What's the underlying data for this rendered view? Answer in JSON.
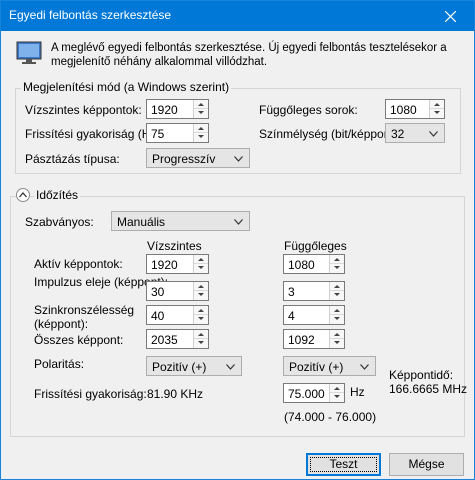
{
  "window": {
    "title": "Egyedi felbontás szerkesztése"
  },
  "intro": "A meglévő egyedi felbontás szerkesztése. Új egyedi felbontás tesztelésekor a megjelenítő néhány alkalommal villódzhat.",
  "display_mode": {
    "group_title": "Megjelenítési mód (a Windows szerint)",
    "horizontal_pixels_label": "Vízszintes képpontok:",
    "horizontal_pixels_value": "1920",
    "vertical_lines_label": "Függőleges sorok:",
    "vertical_lines_value": "1080",
    "refresh_rate_label": "Frissítési gyakoriság (Hz):",
    "refresh_rate_value": "75",
    "color_depth_label": "Színmélység (bit/képpont):",
    "color_depth_value": "32",
    "scan_type_label": "Pásztázás típusa:",
    "scan_type_value": "Progresszív"
  },
  "timing": {
    "section_title": "Időzítés",
    "standard_label": "Szabványos:",
    "standard_value": "Manuális",
    "col_horizontal": "Vízszintes",
    "col_vertical": "Függőleges",
    "active_pixels_label": "Aktív képpontok:",
    "active_h": "1920",
    "active_v": "1080",
    "front_porch_label": "Impulzus eleje (képpont):",
    "front_porch_h": "30",
    "front_porch_v": "3",
    "sync_width_label": "Szinkronszélesség (képpont):",
    "sync_width_h": "40",
    "sync_width_v": "4",
    "total_pixels_label": "Összes képpont:",
    "total_h": "2035",
    "total_v": "1092",
    "polarity_label": "Polaritás:",
    "polarity_h": "Pozitív (+)",
    "polarity_v": "Pozitív (+)",
    "pixel_clock_label": "Képpontidő:",
    "pixel_clock_value": "166.6665 MHz",
    "refresh_label": "Frissítési gyakoriság:",
    "refresh_h_value": "81.90 KHz",
    "refresh_v_value": "75.000",
    "refresh_v_unit": "Hz",
    "refresh_range": "(74.000 - 76.000)"
  },
  "buttons": {
    "test": "Teszt",
    "cancel": "Mégse"
  },
  "colors": {
    "titlebar": "#0078d7",
    "accent": "#0078d7"
  }
}
